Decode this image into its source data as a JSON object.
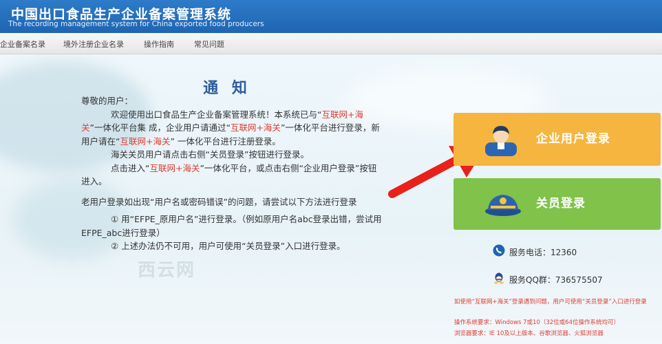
{
  "header": {
    "title_cn": "中国出口食品生产企业备案管理系统",
    "title_en": "The recording management system for China exported food producers"
  },
  "nav": [
    {
      "label": "企业备案名录"
    },
    {
      "label": "境外注册企业名录"
    },
    {
      "label": "操作指南"
    },
    {
      "label": "常见问题"
    }
  ],
  "notice": {
    "title": "通 知",
    "greeting": "尊敬的用户：",
    "p1_a": "欢迎使用出口食品生产企业备案管理系统！本系统已与“",
    "p1_link1": "互联网+海关",
    "p1_b": "”一体化平台集 成，企业用户请通过“",
    "p1_link2": "互联网+海关",
    "p1_c": "”一体化平台进行登录，新用户请在“",
    "p1_link3": "互联网+海关",
    "p1_d": "” 一体化平台进行注册登录。",
    "p2": "海关关员用户请点击右侧“关员登录”按钮进行登录。",
    "p3_a": "点击进入“",
    "p3_link": "互联网+海关",
    "p3_b": "”一体化平台，或点击右侧“企业用户登录”按钮进入。",
    "p4": "老用户登录如出现“用户名或密码错误”的问题，请尝试以下方法进行登录",
    "p5": "① 用“EFPE_原用户名”进行登录。（例如原用户名abc登录出错，尝试用EFPE_abc进行登录）",
    "p6": "② 上述办法仍不可用，用户可使用“关员登录”入口进行登录。"
  },
  "buttons": {
    "corp_login": "企业用户登录",
    "official_login": "关员登录"
  },
  "contact": {
    "phone": "服务电话：12360",
    "qq": "服务QQ群：736575507"
  },
  "footer": {
    "help": "如使用“互联网+海关”登录遇到问题，用户可使用“关员登录”入口进行登录",
    "os_req": "操作系统要求：Windows 7或10（32位或64位操作系统均可）",
    "browser_req": "浏览器要求：IE 10及以上版本、谷歌浏览器、火狐浏览器"
  },
  "watermark": "西云网",
  "colors": {
    "header_blue": "#1f65b1",
    "corp_button": "#f6b53f",
    "official_button": "#80c24a",
    "link_red": "#e03c31",
    "arrow_red": "#e8211b"
  }
}
